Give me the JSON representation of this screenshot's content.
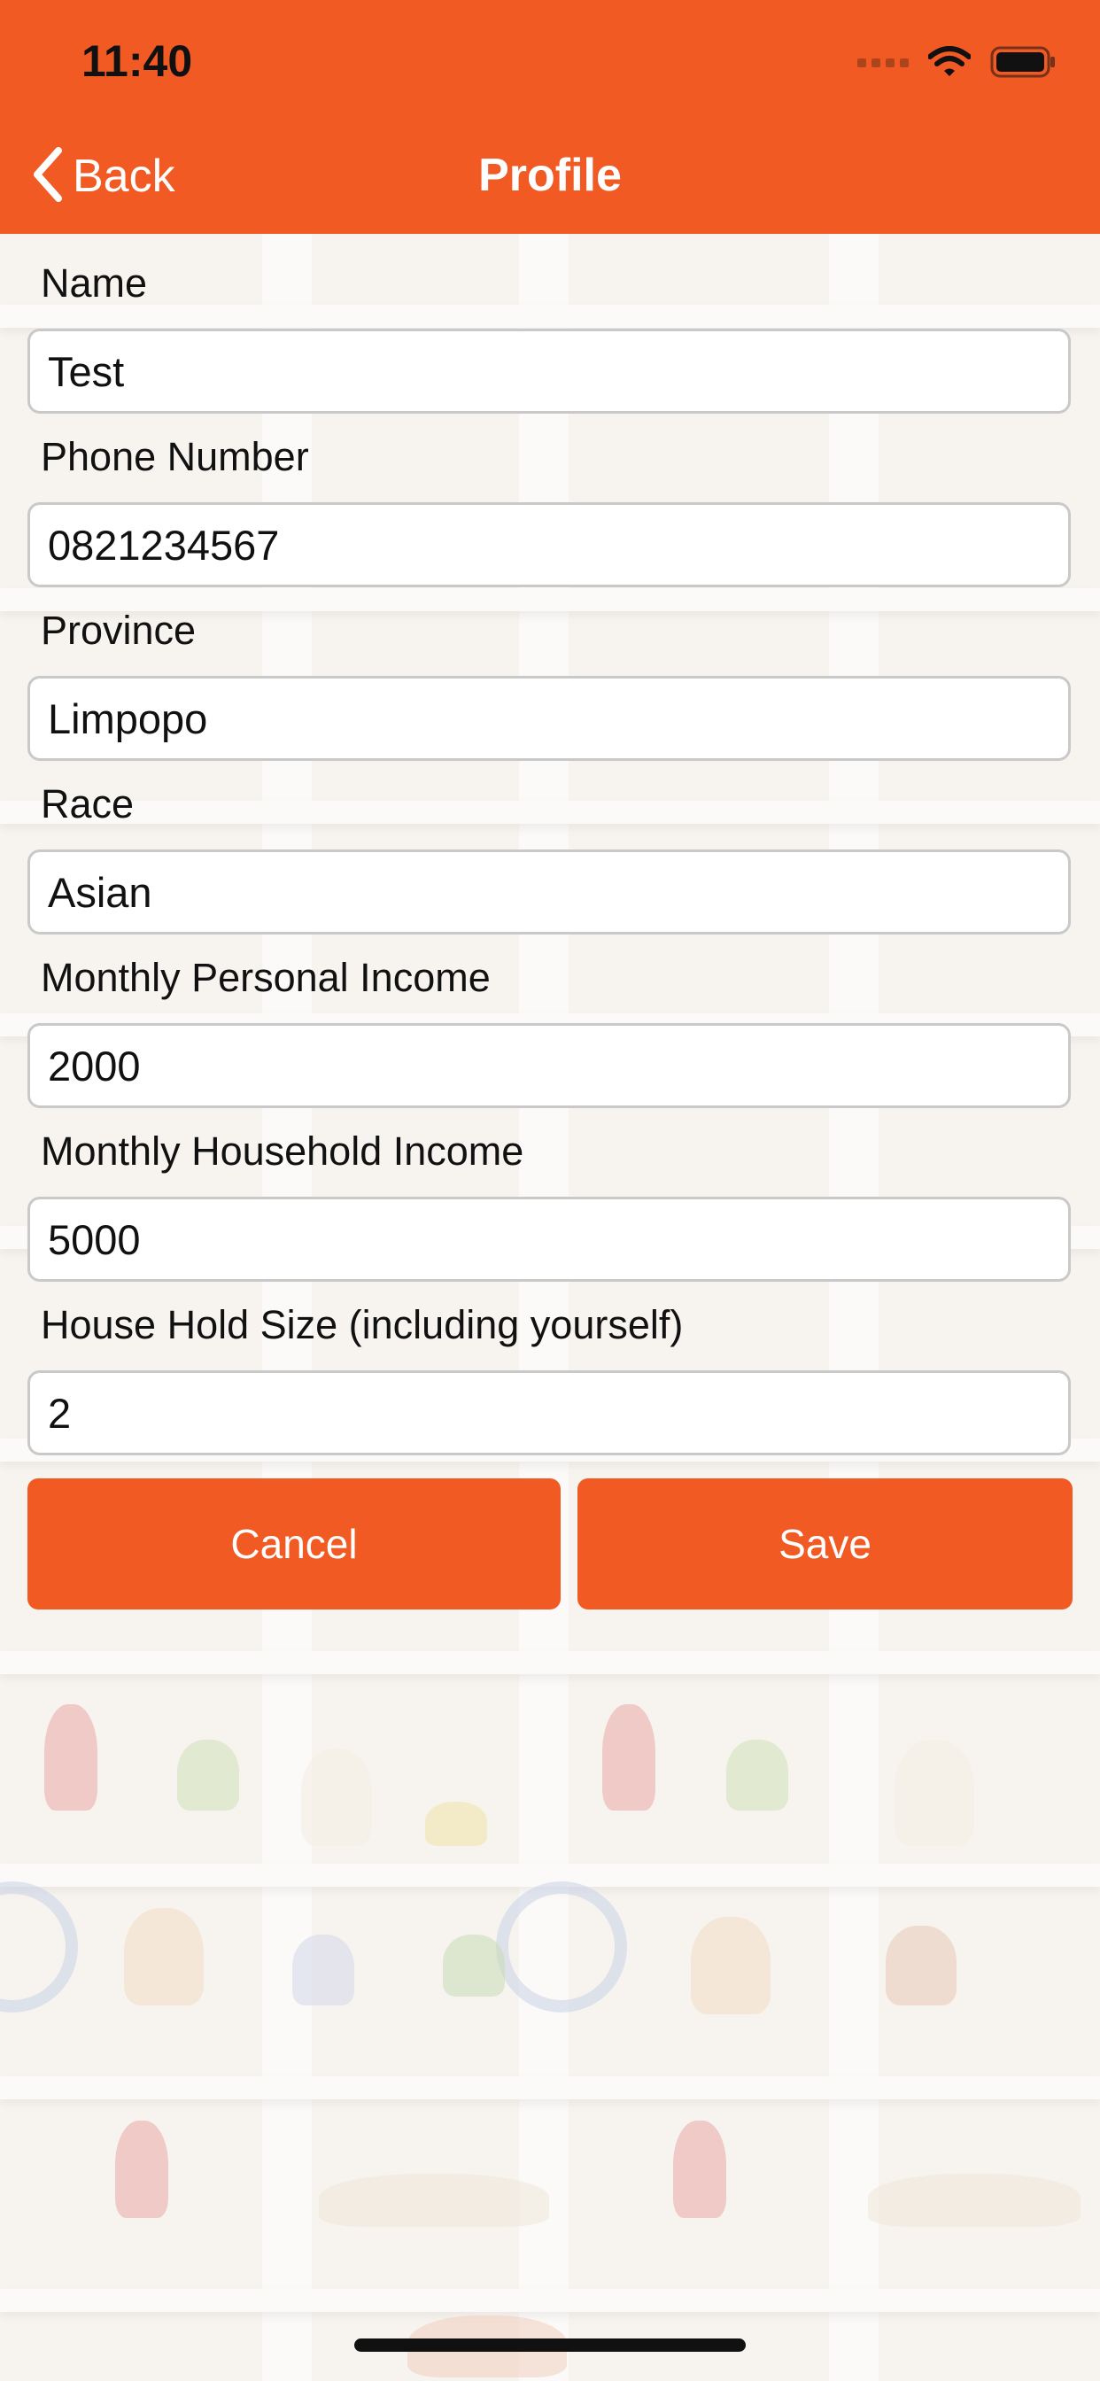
{
  "status_bar": {
    "time": "11:40",
    "icons": [
      "cellular-signal-icon",
      "wifi-icon",
      "battery-icon"
    ]
  },
  "nav": {
    "back_label": "Back",
    "title": "Profile"
  },
  "form": {
    "fields": [
      {
        "label": "Name",
        "value": "Test"
      },
      {
        "label": "Phone Number",
        "value": "0821234567"
      },
      {
        "label": "Province",
        "value": "Limpopo"
      },
      {
        "label": "Race",
        "value": "Asian"
      },
      {
        "label": "Monthly Personal Income",
        "value": "2000"
      },
      {
        "label": "Monthly Household Income",
        "value": "5000"
      },
      {
        "label": "House Hold Size (including yourself)",
        "value": "2"
      }
    ],
    "cancel_label": "Cancel",
    "save_label": "Save"
  },
  "colors": {
    "accent": "#f25a23",
    "text": "#111111",
    "input_border": "#c9c9c9"
  }
}
